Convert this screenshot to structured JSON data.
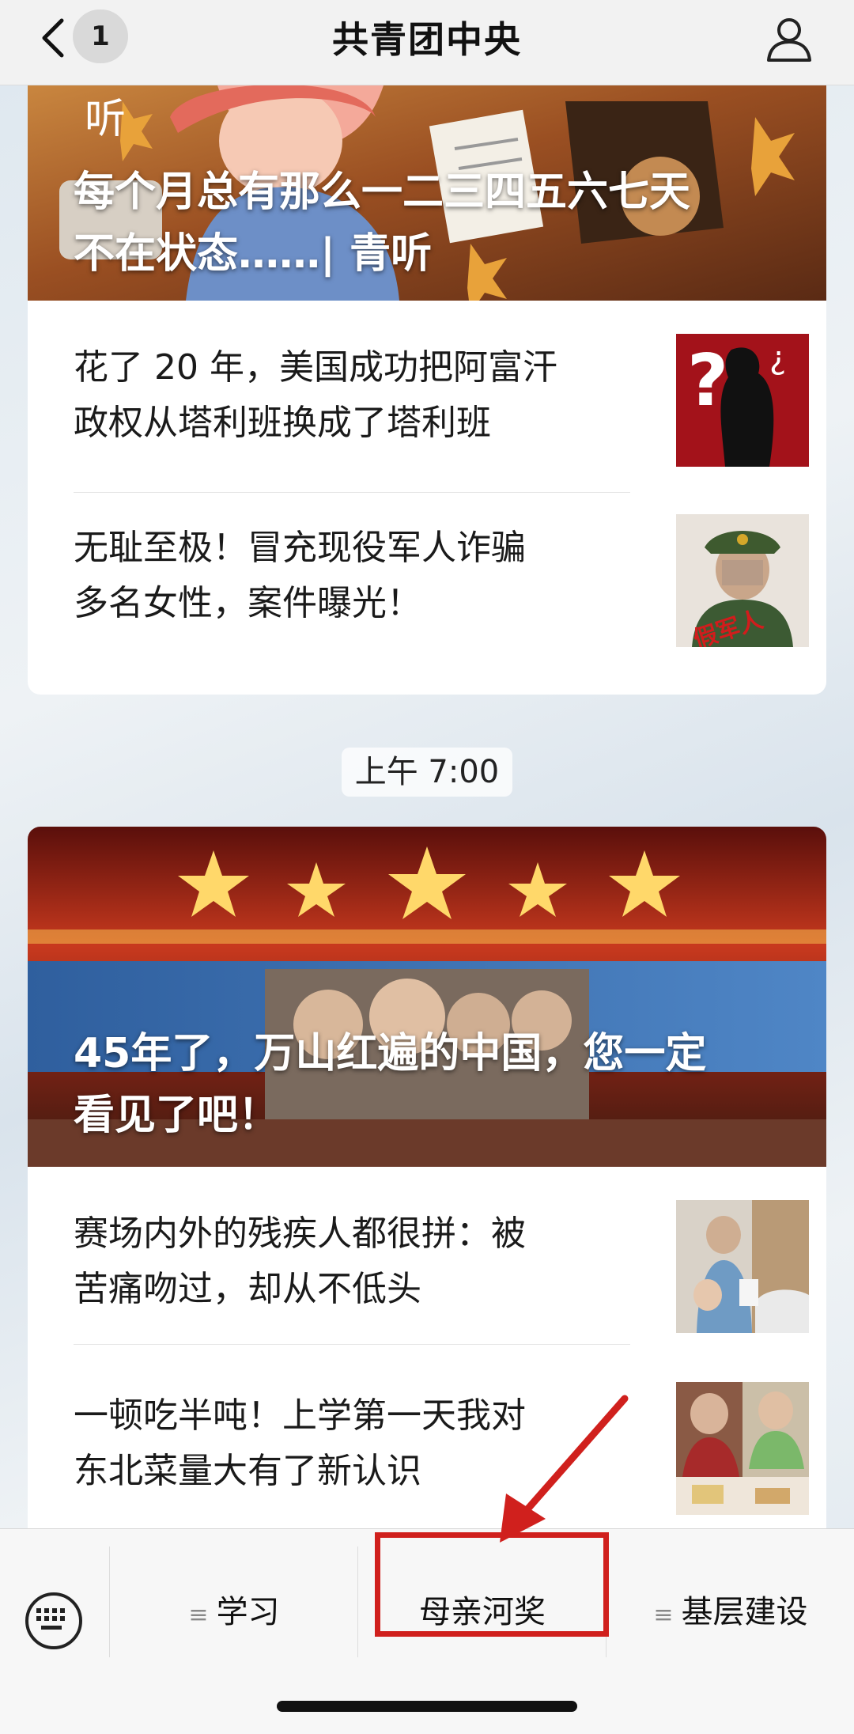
{
  "nav": {
    "back_count": "1",
    "title": "共青团中央"
  },
  "feed": {
    "block1": {
      "hero_title_line1": "每个月总有那么一二三四五六七天",
      "hero_title_line2": "不在状态……| 青听",
      "hero_logo": "听",
      "items": [
        {
          "title_line1": "花了 20 年，美国成功把阿富汗",
          "title_line2": "政权从塔利班换成了塔利班"
        },
        {
          "title_line1": "无耻至极！冒充现役军人诈骗",
          "title_line2": "多名女性，案件曝光！",
          "thumb_text": "假军人"
        }
      ]
    },
    "timestamp": "上午 7:00",
    "block2": {
      "hero_title_line1": "45年了，万山红遍的中国，您一定",
      "hero_title_line2": "看见了吧！",
      "items": [
        {
          "title_line1": "赛场内外的残疾人都很拼：被",
          "title_line2": "苦痛吻过，却从不低头"
        },
        {
          "title_line1": "一顿吃半吨！上学第一天我对",
          "title_line2": "东北菜量大有了新认识"
        }
      ]
    }
  },
  "menu": {
    "items": [
      {
        "label": "学习",
        "has_submenu": true
      },
      {
        "label": "母亲河奖",
        "has_submenu": false
      },
      {
        "label": "基层建设",
        "has_submenu": true
      }
    ],
    "submenu_glyph": "≡"
  },
  "annotation": {
    "color": "#d0201d"
  },
  "icons": [
    "back-chevron-icon",
    "profile-icon",
    "keyboard-icon",
    "menu-lines-icon",
    "annotation-arrow-icon"
  ]
}
